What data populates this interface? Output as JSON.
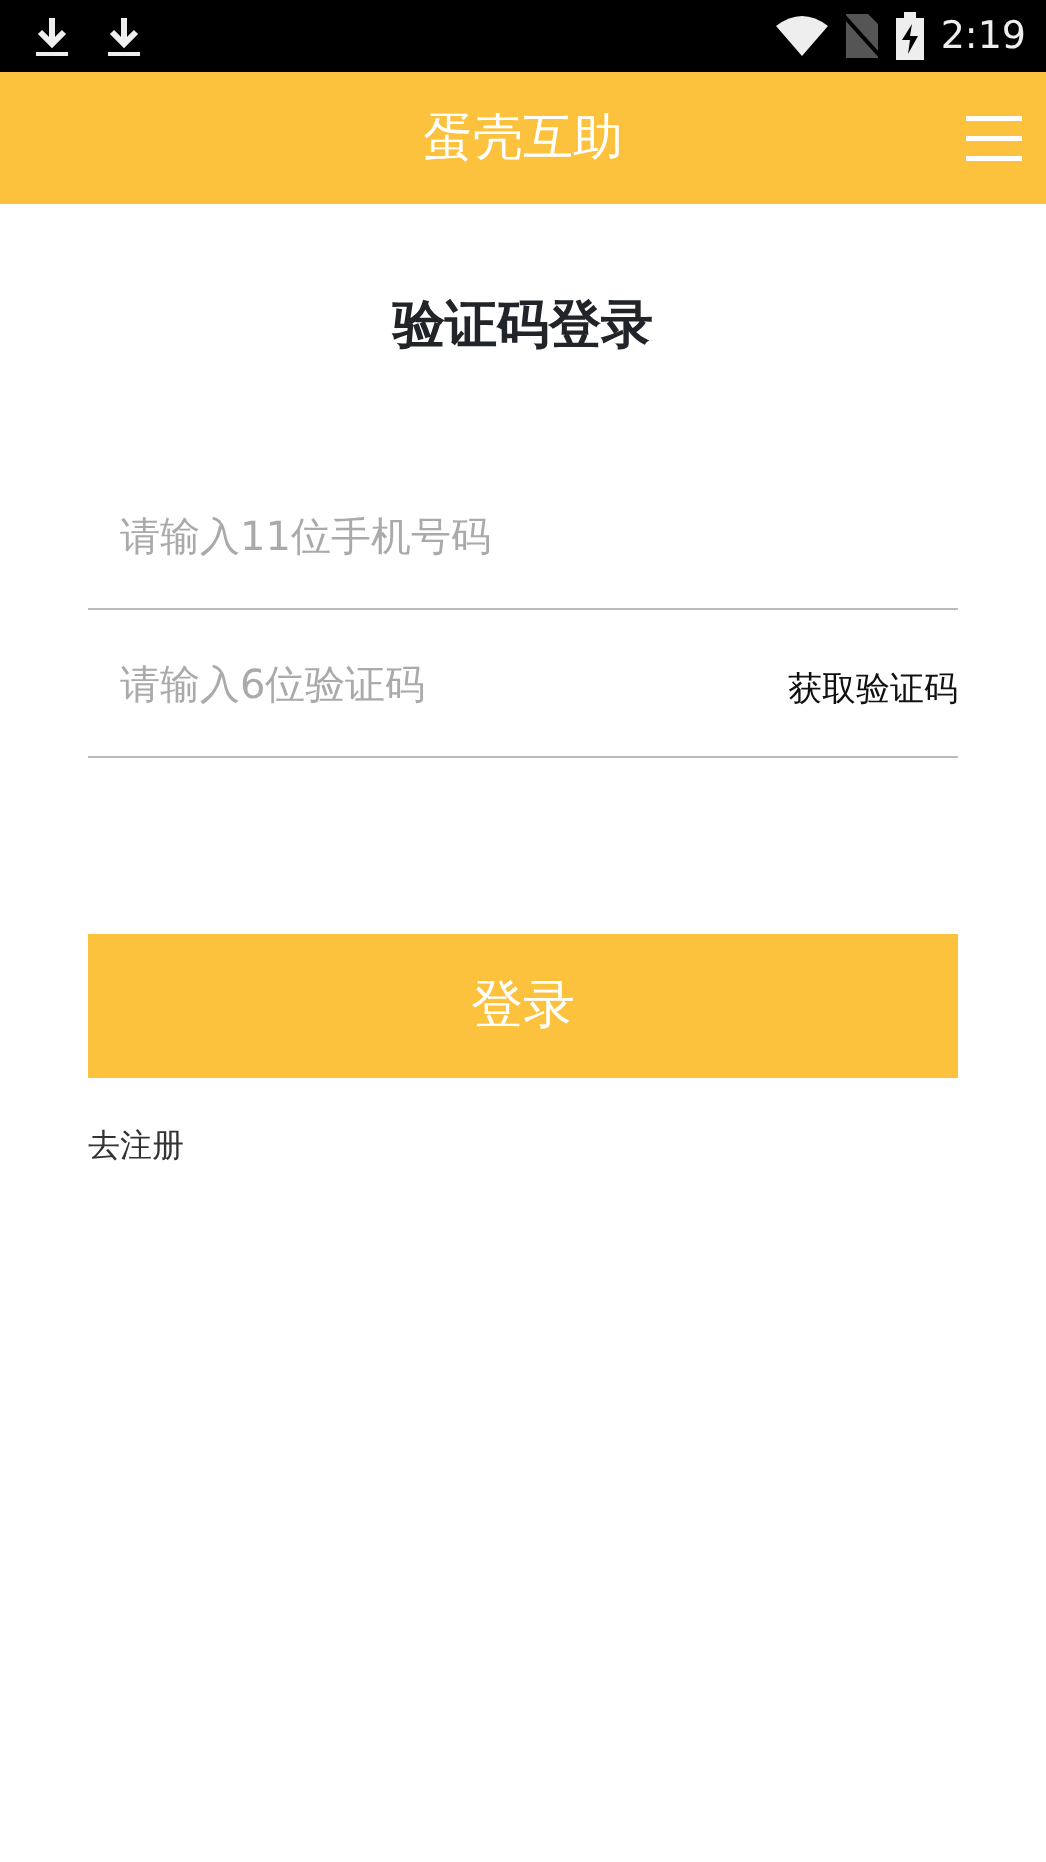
{
  "status_bar": {
    "time": "2:19"
  },
  "app_bar": {
    "title": "蛋壳互助"
  },
  "heading": "验证码登录",
  "phone_field": {
    "placeholder": "请输入11位手机号码"
  },
  "code_field": {
    "placeholder": "请输入6位验证码"
  },
  "get_code_link": "获取验证码",
  "login_button": "登录",
  "register_link": "去注册"
}
